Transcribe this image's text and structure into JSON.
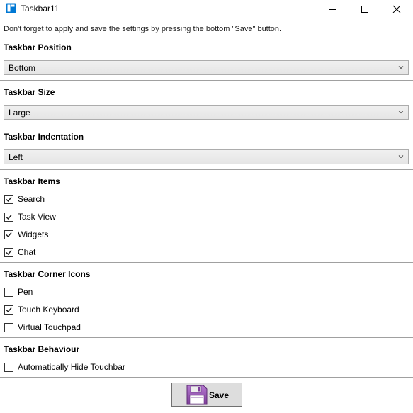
{
  "window": {
    "title": "Taskbar11",
    "controls": [
      "minimize",
      "maximize",
      "close"
    ]
  },
  "hint": "Don't forget to apply and save the settings by pressing the bottom \"Save\" button.",
  "position": {
    "title": "Taskbar Position",
    "selected": "Bottom"
  },
  "size": {
    "title": "Taskbar Size",
    "selected": "Large"
  },
  "indentation": {
    "title": "Taskbar Indentation",
    "selected": "Left"
  },
  "items": {
    "title": "Taskbar Items",
    "options": [
      {
        "label": "Search",
        "checked": true
      },
      {
        "label": "Task View",
        "checked": true
      },
      {
        "label": "Widgets",
        "checked": true
      },
      {
        "label": "Chat",
        "checked": true
      }
    ]
  },
  "corner_icons": {
    "title": "Taskbar Corner Icons",
    "options": [
      {
        "label": "Pen",
        "checked": false
      },
      {
        "label": "Touch Keyboard",
        "checked": true
      },
      {
        "label": "Virtual Touchpad",
        "checked": false
      }
    ]
  },
  "behaviour": {
    "title": "Taskbar Behaviour",
    "options": [
      {
        "label": "Automatically Hide Touchbar",
        "checked": false
      }
    ]
  },
  "save": {
    "label": "Save",
    "icon": "floppy-disk-icon"
  },
  "colors": {
    "accent": "#0078d4",
    "save_icon": "#8e44ad"
  }
}
